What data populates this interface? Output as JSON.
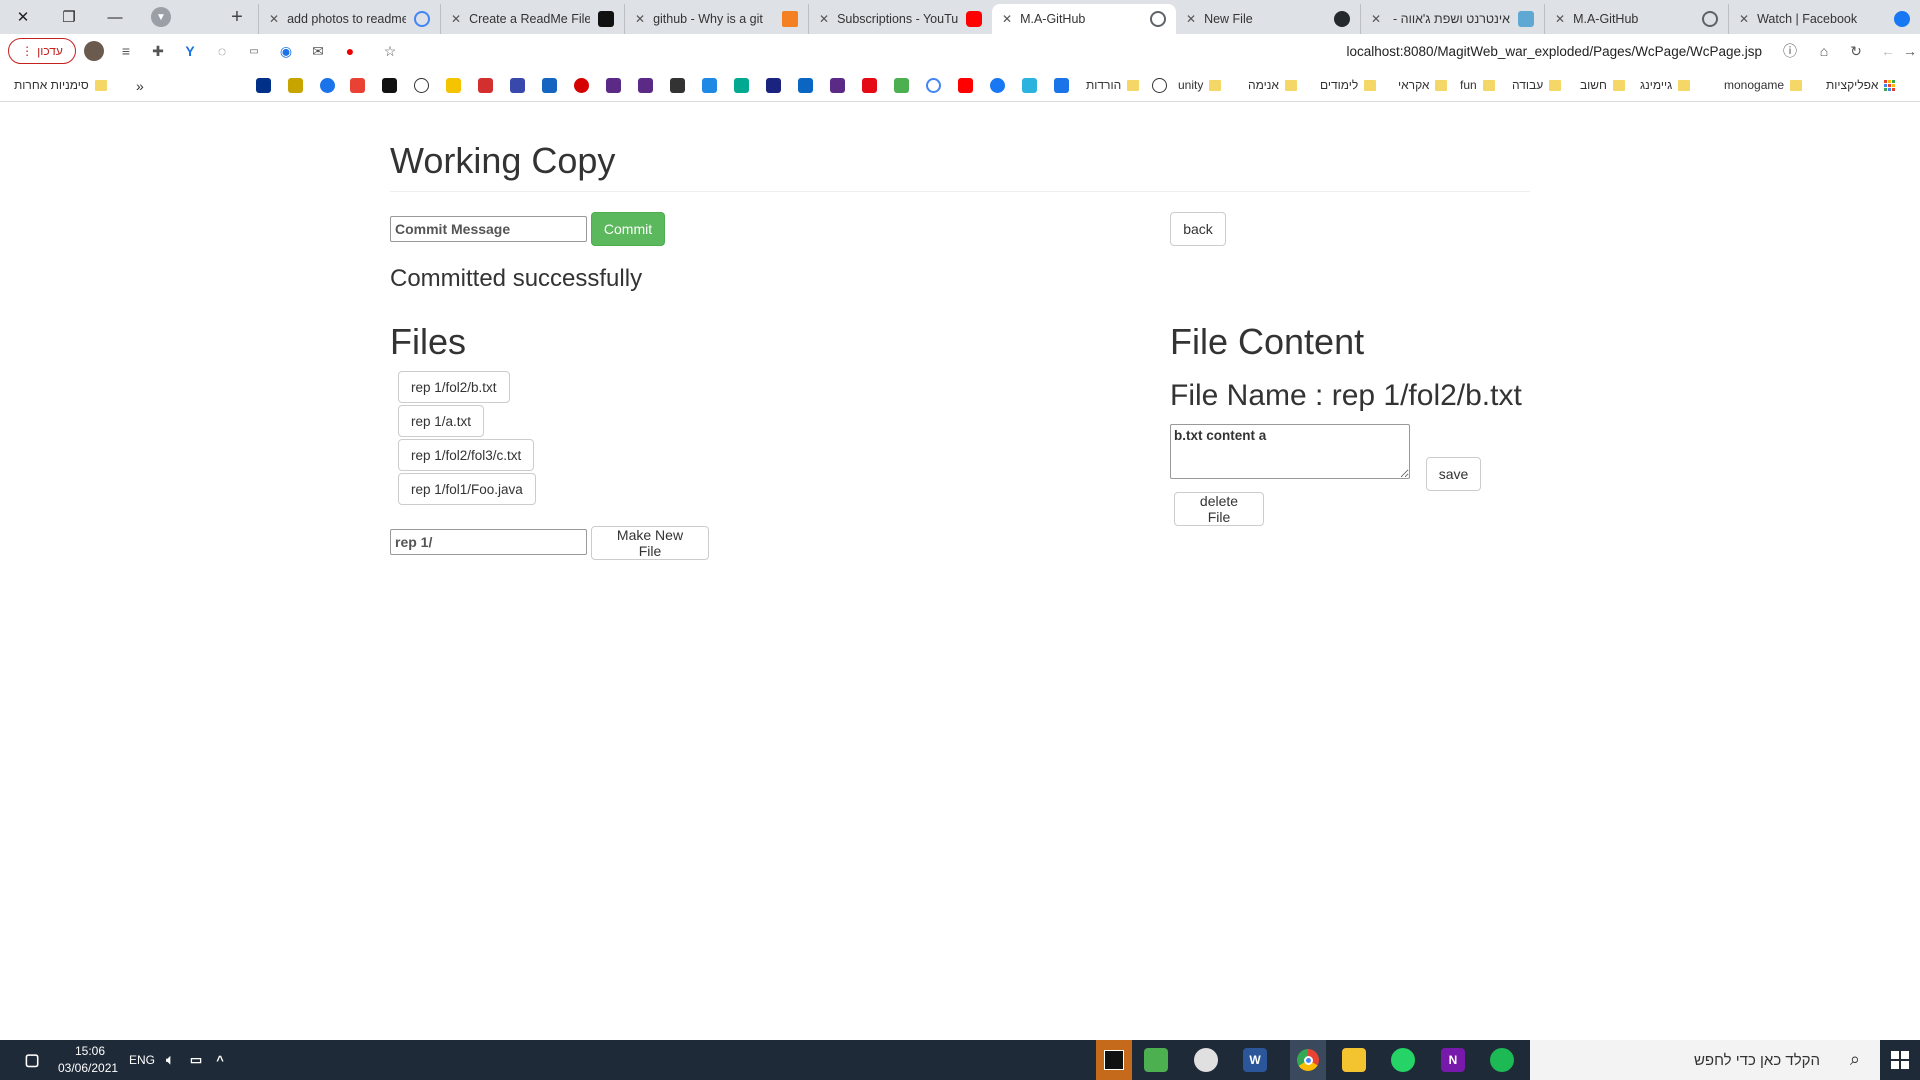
{
  "browser": {
    "tabs": [
      {
        "title": "add photos to readme",
        "favicon": "google-icon",
        "color": "#4285f4",
        "active": false
      },
      {
        "title": "Create a ReadMe File",
        "favicon": "n-logo-icon",
        "color": "#111111",
        "active": false
      },
      {
        "title": "github - Why is a git",
        "favicon": "stackoverflow-icon",
        "color": "#f48024",
        "active": false
      },
      {
        "title": "Subscriptions - YouTube",
        "favicon": "youtube-icon",
        "color": "#ff0000",
        "active": false
      },
      {
        "title": "M.A-GitHub",
        "favicon": "globe-icon",
        "color": "#5f6368",
        "active": true
      },
      {
        "title": "New File",
        "favicon": "github-icon",
        "color": "#24292e",
        "active": false
      },
      {
        "title": "אינטרנט ושפת ג'אווה -",
        "favicon": "site-icon",
        "color": "#5fa8d3",
        "active": false
      },
      {
        "title": "M.A-GitHub",
        "favicon": "globe-icon",
        "color": "#5f6368",
        "active": false
      },
      {
        "title": "Watch | Facebook",
        "favicon": "facebook-icon",
        "color": "#1877f2",
        "active": false
      }
    ],
    "update_label": "עדכון",
    "url": "localhost:8080/MagitWeb_war_exploded/Pages/WcPage/WcPage.jsp",
    "bookmarks": {
      "other": "סימניות אחרות",
      "more": "»",
      "folders": [
        "הורדות",
        "unity",
        "אנימה",
        "לימודים",
        "אקראי",
        "fun",
        "עבודה",
        "חשוב",
        "גיימינג",
        "monogame",
        "אפליקציות"
      ]
    }
  },
  "page": {
    "title": "Working Copy",
    "commit_placeholder": "Commit Message",
    "commit_button": "Commit",
    "back_button": "back",
    "status_message": "Committed successfully",
    "files_heading": "Files",
    "files": [
      "rep 1/fol2/b.txt",
      "rep 1/a.txt",
      "rep 1/fol2/fol3/c.txt",
      "rep 1/fol1/Foo.java"
    ],
    "new_file_value": "rep 1/",
    "make_new_file_button": "Make New File",
    "content_heading": "File Content",
    "file_name_label": "File Name : rep 1/fol2/b.txt",
    "file_content": "b.txt content a",
    "save_button": "save",
    "delete_button": "delete File",
    "colors": {
      "success": "#5cb85c",
      "text": "#333333"
    }
  },
  "taskbar": {
    "time": "15:06",
    "date": "03/06/2021",
    "language": "ENG",
    "search_placeholder": "הקלד כאן כדי לחפש",
    "apps": [
      "intellij-icon",
      "notepad-icon",
      "paint-icon",
      "word-icon",
      "chrome-icon",
      "file-explorer-icon",
      "whatsapp-icon",
      "onenote-icon",
      "spotify-icon"
    ]
  }
}
